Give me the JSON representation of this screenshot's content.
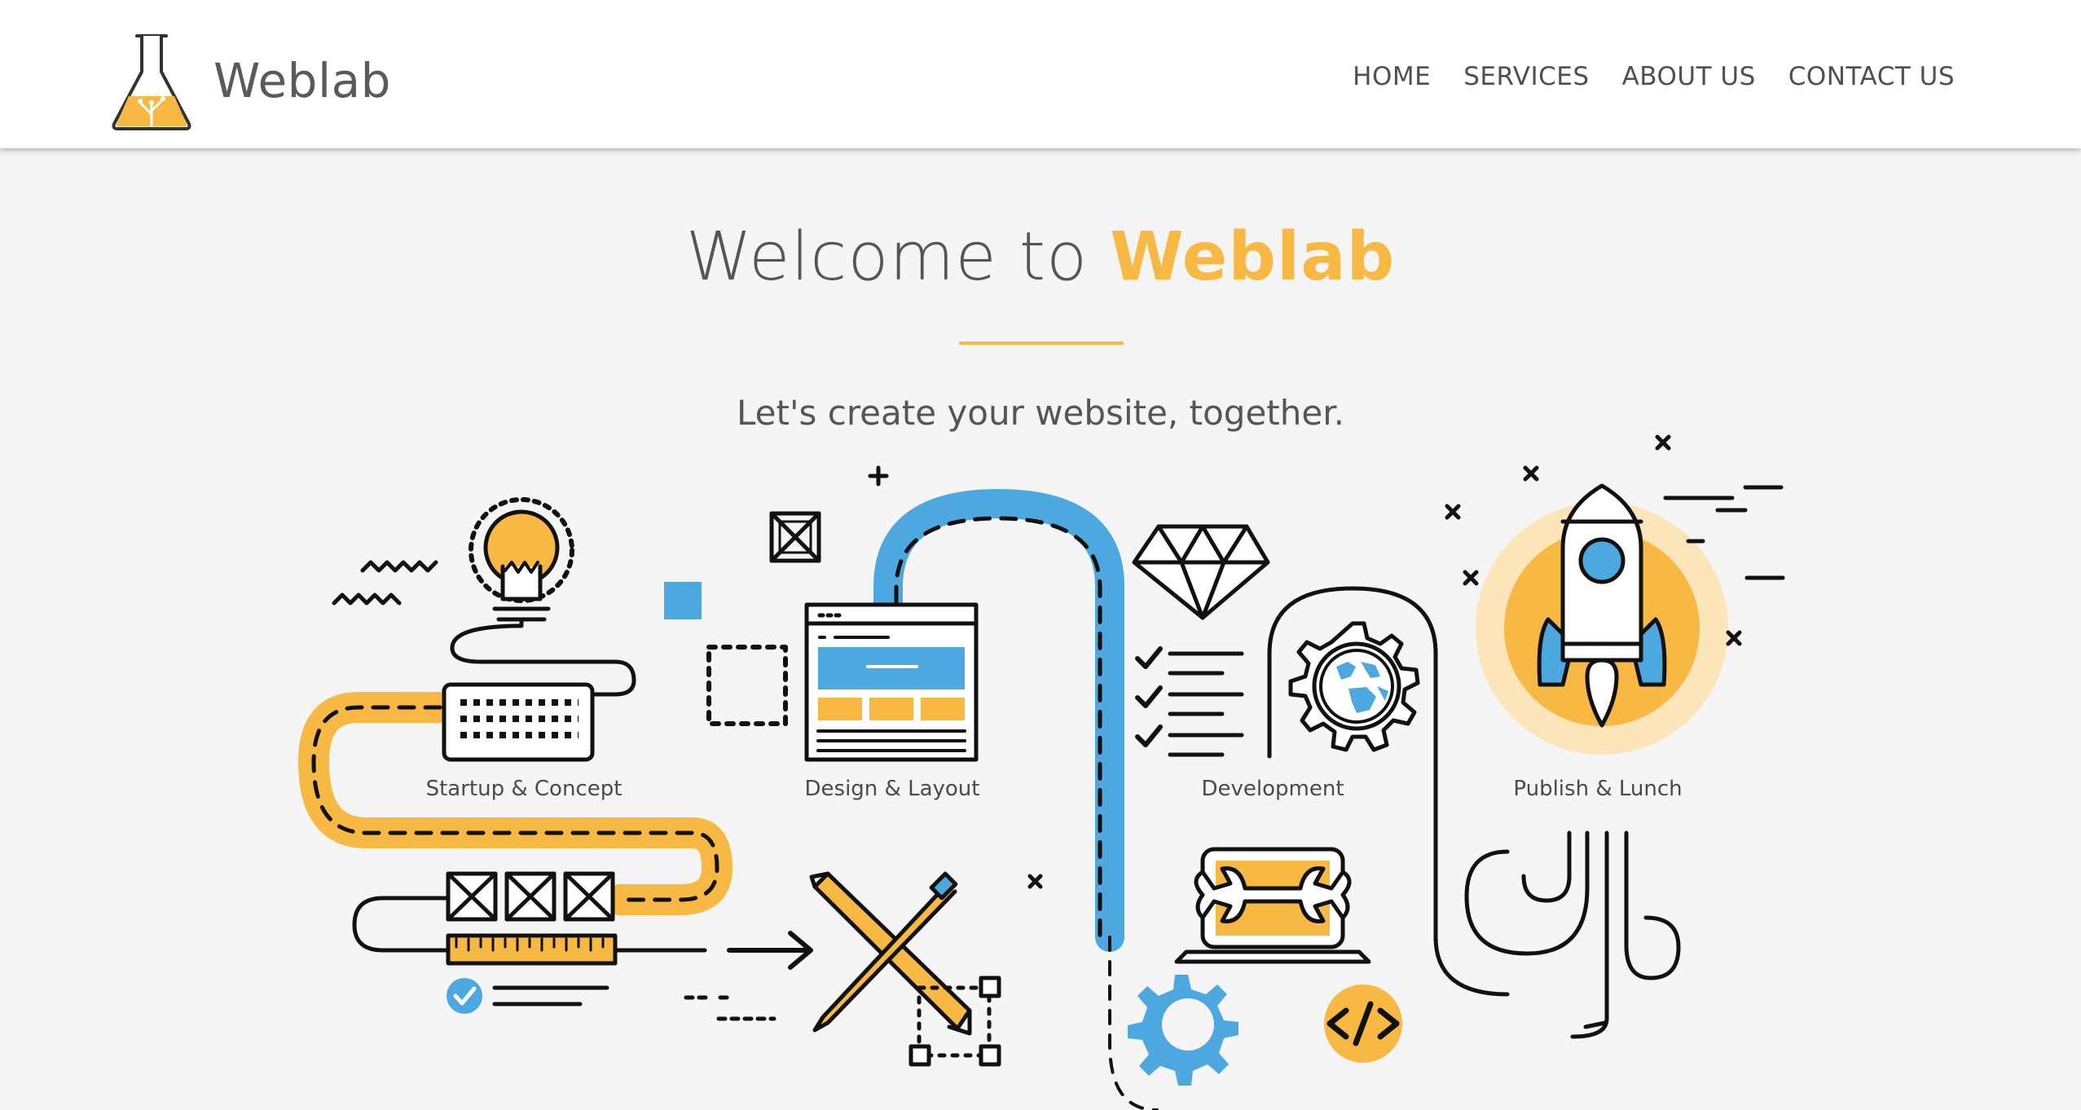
{
  "brand": {
    "name": "Weblab",
    "logo_icon": "flask-icon"
  },
  "nav": {
    "items": [
      "HOME",
      "SERVICES",
      "ABOUT US",
      "CONTACT US"
    ]
  },
  "hero": {
    "title_prefix": "Welcome to ",
    "title_accent": "Weblab",
    "subtitle": "Let's create your website, together."
  },
  "stages": {
    "startup": "Startup & Concept",
    "design": "Design & Layout",
    "development": "Development",
    "publish": "Publish & Lunch"
  },
  "colors": {
    "accent": "#f7b844",
    "blue": "#4ea8e0",
    "text": "#555555",
    "background": "#f4f5f4"
  }
}
